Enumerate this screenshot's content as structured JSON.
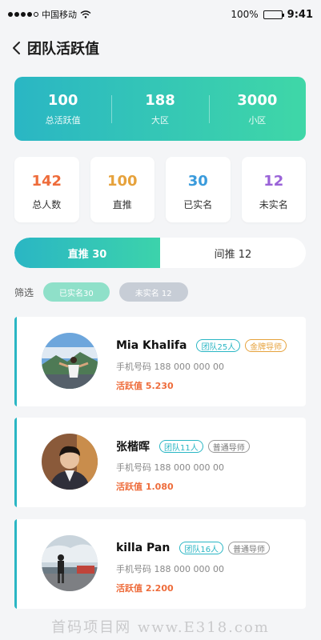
{
  "status_bar": {
    "carrier": "中国移动",
    "battery": "100%",
    "time": "9:41"
  },
  "header": {
    "title": "团队活跃值"
  },
  "summary": [
    {
      "value": "100",
      "label": "总活跃值"
    },
    {
      "value": "188",
      "label": "大区"
    },
    {
      "value": "3000",
      "label": "小区"
    }
  ],
  "stats": [
    {
      "value": "142",
      "label": "总人数",
      "color": "#ee6c3b"
    },
    {
      "value": "100",
      "label": "直推",
      "color": "#e6a23c"
    },
    {
      "value": "30",
      "label": "已实名",
      "color": "#3a9bdc"
    },
    {
      "value": "12",
      "label": "未实名",
      "color": "#9a63d8"
    }
  ],
  "tabs": {
    "direct": "直推 30",
    "indirect": "间推 12"
  },
  "filter": {
    "label": "筛选",
    "verified": "已实名30",
    "unverified": "未实名 12"
  },
  "members": [
    {
      "name": "Mia Khalifa",
      "team": "团队25人",
      "role": "金牌导师",
      "phone": "手机号码  188 000 000 00",
      "activity": "活跃值  5.230"
    },
    {
      "name": "张楷晖",
      "team": "团队11人",
      "role": "普通导师",
      "phone": "手机号码  188 000 000 00",
      "activity": "活跃值  1.080"
    },
    {
      "name": "killa Pan",
      "team": "团队16人",
      "role": "普通导师",
      "phone": "手机号码  188 000 000 00",
      "activity": "活跃值  2.200"
    }
  ],
  "watermark": "首码项目网  www.E318.com"
}
